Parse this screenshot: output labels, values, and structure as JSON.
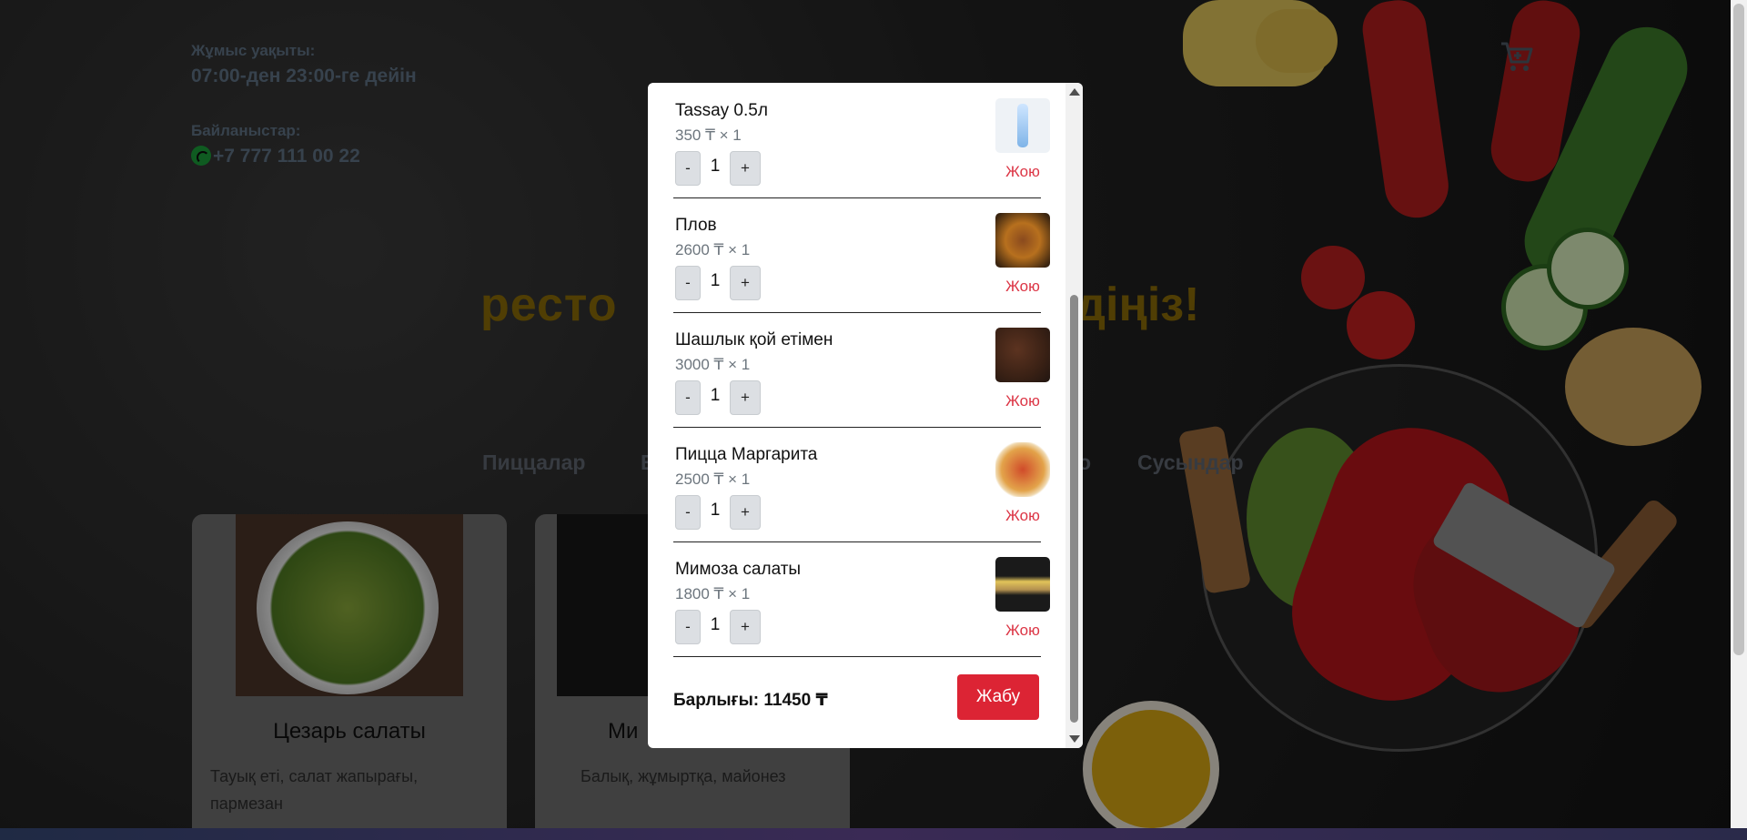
{
  "info": {
    "hours_label": "Жұмыс уақыты:",
    "hours_value": "07:00-ден 23:00-ге дейін",
    "contacts_label": "Байланыстар:",
    "phone": "+7 777 111 00 22"
  },
  "hero": {
    "left_text": "ресто",
    "right_text": "діңіз!"
  },
  "nav": {
    "items": [
      "Пиццалар",
      "Е",
      "о",
      "Сусындар"
    ]
  },
  "menu_cards": [
    {
      "title": "Цезарь салаты",
      "description": "Тауық еті, салат жапырағы, пармезан"
    },
    {
      "title": "Ми",
      "description": "Балық, жұмыртқа, майонез"
    }
  ],
  "cart": {
    "items": [
      {
        "name": "Tassay 0.5л",
        "price_line": "350 ₸ × 1",
        "qty": "1",
        "image": "water-bottle"
      },
      {
        "name": "Плов",
        "price_line": "2600 ₸ × 1",
        "qty": "1",
        "image": "plov"
      },
      {
        "name": "Шашлык қой етімен",
        "price_line": "3000 ₸ × 1",
        "qty": "1",
        "image": "shashlyk"
      },
      {
        "name": "Пицца Маргарита",
        "price_line": "2500 ₸ × 1",
        "qty": "1",
        "image": "pizza"
      },
      {
        "name": "Мимоза салаты",
        "price_line": "1800 ₸ × 1",
        "qty": "1",
        "image": "mimoza-salad"
      }
    ],
    "minus_label": "-",
    "plus_label": "+",
    "remove_label": "Жою",
    "total_text": "Барлығы: 11450 ₸",
    "close_label": "Жабу"
  },
  "colors": {
    "accent_red": "#dc2434",
    "remove_red": "#dc3545",
    "muted_gold": "#8a6b08"
  }
}
